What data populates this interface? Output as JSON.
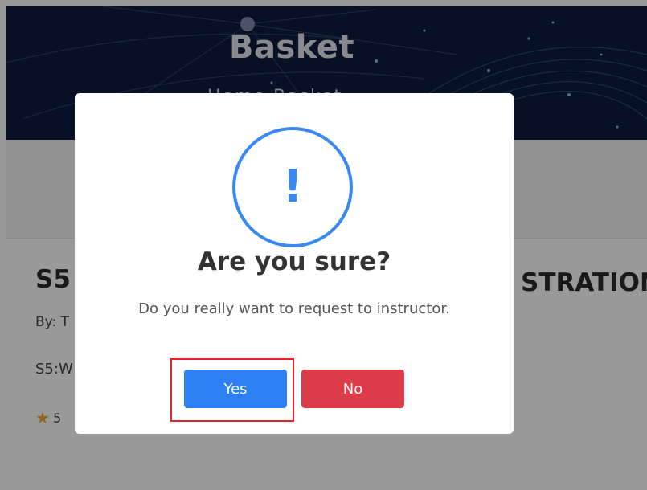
{
  "hero": {
    "title": "Basket",
    "breadcrumb": "Home   Basket"
  },
  "course": {
    "title_fragment": "S5",
    "title_tail": "STRATION",
    "by_fragment": "By: T",
    "subtitle_fragment": "S5:W",
    "rating_fragment": "5"
  },
  "dialog": {
    "icon": "exclamation-icon",
    "icon_glyph": "!",
    "title": "Are you sure?",
    "message": "Do you really want to request to instructor.",
    "yes_label": "Yes",
    "no_label": "No"
  },
  "colors": {
    "hero_bg": "#0e1b40",
    "accent_blue": "#2e7ff1",
    "danger_red": "#dc3c49",
    "highlight_red": "#e8202a"
  }
}
